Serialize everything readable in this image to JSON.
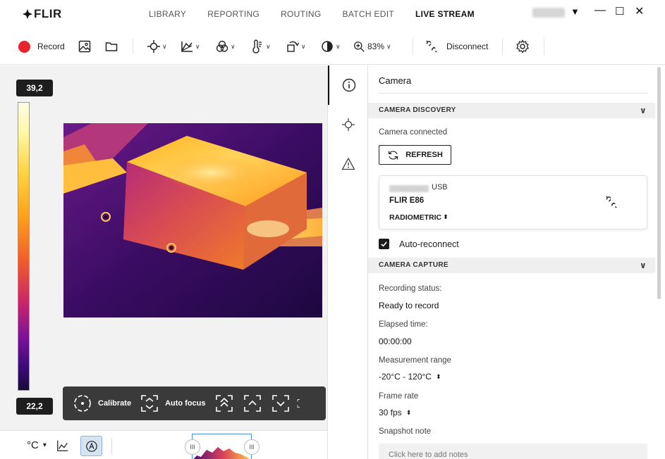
{
  "app": {
    "logo_text": "FLIR"
  },
  "nav": {
    "tabs": [
      "LIBRARY",
      "REPORTING",
      "ROUTING",
      "BATCH EDIT",
      "LIVE STREAM"
    ],
    "active": "LIVE STREAM"
  },
  "window": {
    "dropdown_icon": "▼",
    "minimize_icon": "—",
    "maximize_icon": "☐",
    "close_icon": "✕"
  },
  "toolbar": {
    "record_label": "Record",
    "zoom_label": "83%",
    "disconnect_label": "Disconnect",
    "record_color": "#e8232c"
  },
  "scale": {
    "max_label": "39,2",
    "min_label": "22,2"
  },
  "controls": {
    "calibrate_label": "Calibrate",
    "autofocus_label": "Auto focus"
  },
  "bottombar": {
    "unit_label": "°C",
    "unit_chevron": "▾"
  },
  "panel": {
    "title": "Camera",
    "discovery": {
      "header": "CAMERA DISCOVERY",
      "status": "Camera connected",
      "refresh_label": "REFRESH",
      "card": {
        "connection": "USB",
        "model": "FLIR E86",
        "mode": "RADIOMETRIC"
      },
      "auto_reconnect_label": "Auto-reconnect",
      "auto_reconnect_checked": true
    },
    "capture": {
      "header": "CAMERA CAPTURE",
      "recording_status_label": "Recording status:",
      "recording_status_value": "Ready to record",
      "elapsed_label": "Elapsed time:",
      "elapsed_value": "00:00:00",
      "range_label": "Measurement range",
      "range_value": "-20°C - 120°C",
      "frame_rate_label": "Frame rate",
      "frame_rate_value": "30 fps",
      "snapshot_label": "Snapshot note",
      "notes_placeholder": "Click here to add notes"
    }
  }
}
